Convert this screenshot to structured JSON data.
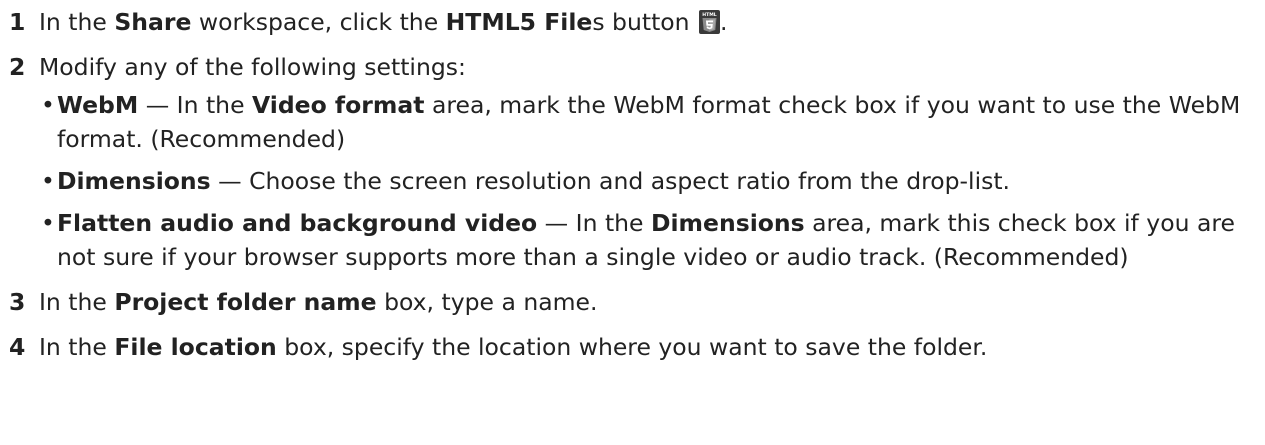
{
  "steps": [
    {
      "number": "1",
      "parts": {
        "t1": "In the ",
        "b1": "Share",
        "t2": " workspace, click the ",
        "b2": "HTML5 File",
        "t3": "s button ",
        "t4": "."
      },
      "icon": "html5-icon",
      "icon_text": "HTML"
    },
    {
      "number": "2",
      "text": "Modify any of the following settings:",
      "bullets": [
        {
          "b1": "WebM",
          "t1": " — In the ",
          "b2": "Video format",
          "t2": " area, mark the WebM format check box if you want to use the WebM format. (Recommended)"
        },
        {
          "b1": "Dimensions",
          "t1": " — Choose the screen resolution and aspect ratio from the drop-list."
        },
        {
          "b1": "Flatten audio and background video",
          "t1": " — In the ",
          "b2": "Dimensions",
          "t2": " area, mark this check box if you are not sure if your browser supports more than a single video or audio track. (Recommended)"
        }
      ]
    },
    {
      "number": "3",
      "parts": {
        "t1": "In the ",
        "b1": "Project folder name",
        "t2": " box, type a name."
      }
    },
    {
      "number": "4",
      "parts": {
        "t1": "In the ",
        "b1": "File location",
        "t2": " box, specify the location where you want to save the folder."
      }
    }
  ],
  "bullet_char": "•"
}
